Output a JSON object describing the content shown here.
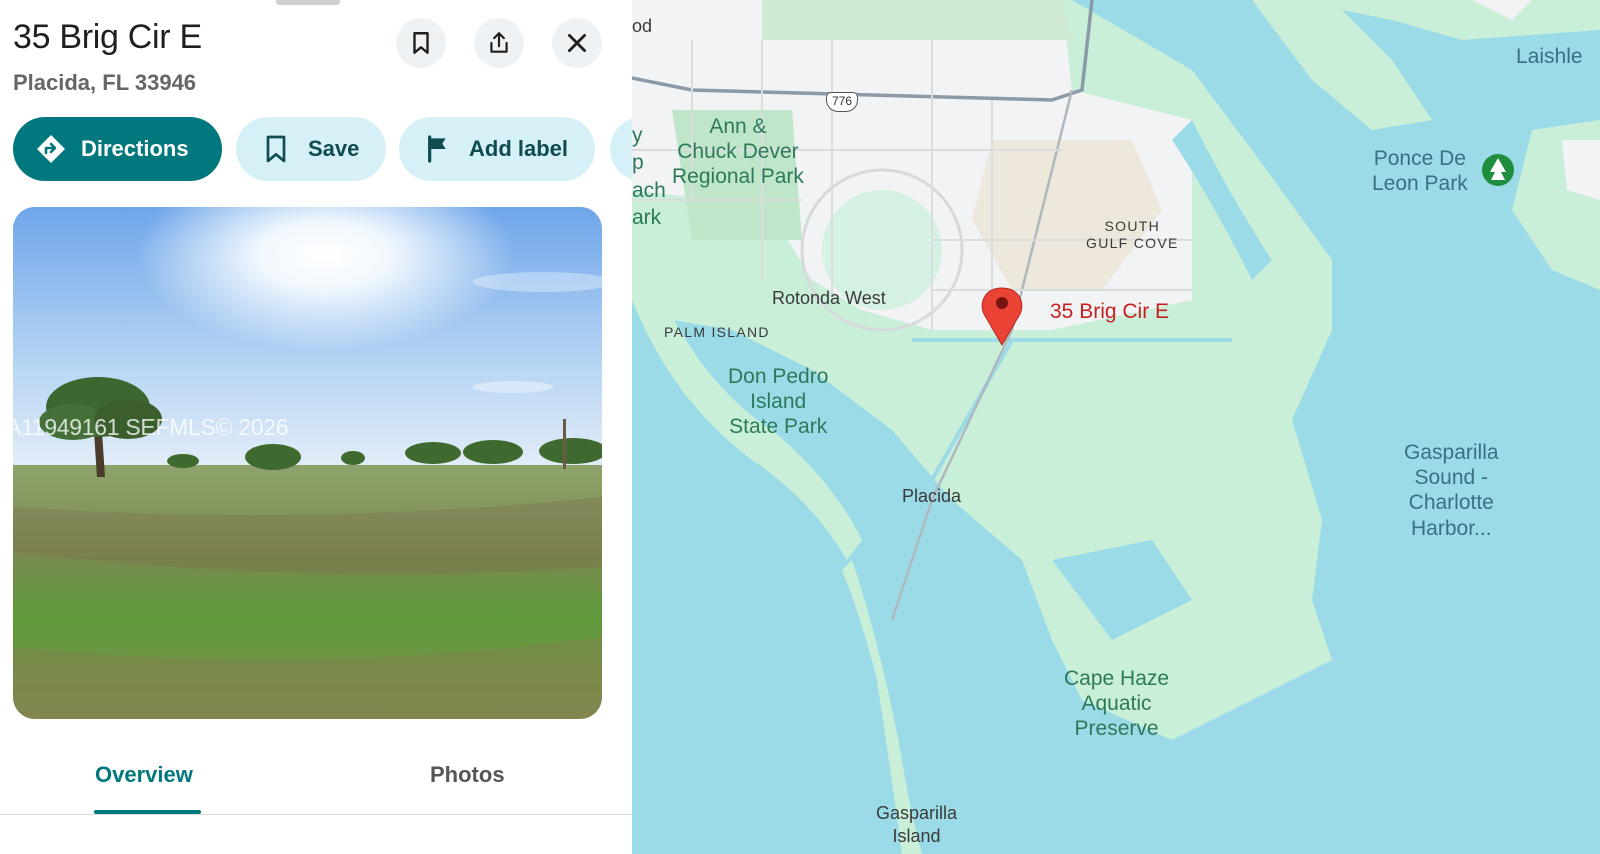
{
  "place": {
    "title": "35 Brig Cir E",
    "subtitle": "Placida, FL 33946"
  },
  "header_buttons": [
    {
      "icon": "bookmark-icon",
      "label": "Save"
    },
    {
      "icon": "share-icon",
      "label": "Share"
    },
    {
      "icon": "close-icon",
      "label": "Close"
    }
  ],
  "actions": {
    "directions": "Directions",
    "save": "Save",
    "add_label": "Add label"
  },
  "photo": {
    "watermark": "A11949161 SEFMLS© 2026"
  },
  "tabs": {
    "overview": "Overview",
    "photos": "Photos",
    "active": "Overview"
  },
  "map": {
    "pin_label": "35 Brig Cir E",
    "route_shield": "776",
    "labels": {
      "edge_left_top": "od",
      "edge_left_mid": "y\np\nach\nark",
      "laishle": "Laishle",
      "ann_chuck": "Ann &\nChuck Dever\nRegional Park",
      "ponce": "Ponce De\nLeon Park",
      "south_gulf": "SOUTH\nGULF COVE",
      "rotonda": "Rotonda West",
      "palm_island": "PALM ISLAND",
      "don_pedro": "Don Pedro\nIsland\nState Park",
      "placida": "Placida",
      "gasparilla_sound": "Gasparilla\nSound -\nCharlotte\nHarbor...",
      "cape_haze": "Cape Haze\nAquatic\nPreserve",
      "gasparilla_island": "Gasparilla\nIsland"
    },
    "colors": {
      "water": "#9bdbe8",
      "land": "#c9efd8",
      "urban": "#f1f3f4",
      "pin": "#ea4335",
      "accent": "#00787d"
    }
  }
}
